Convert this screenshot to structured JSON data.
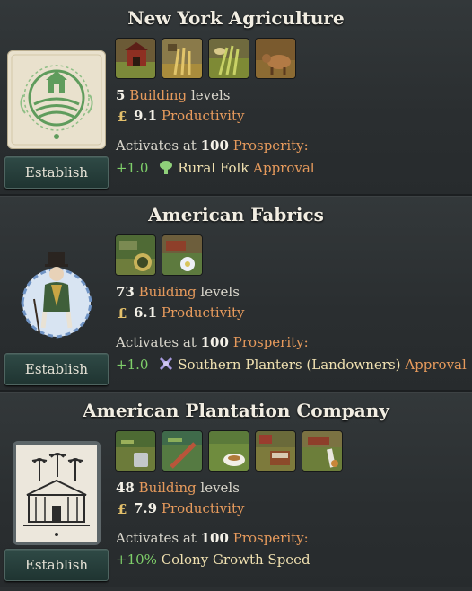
{
  "panels": [
    {
      "title": "New York Agriculture",
      "emblem": "farm-emblem",
      "building_icons": [
        "barn-building-icon",
        "wheat-farm-icon",
        "rye-farm-icon",
        "livestock-ranch-icon"
      ],
      "building_count": "5",
      "building_word": "Building",
      "levels_word": "levels",
      "productivity_value": "9.1",
      "productivity_word": "Productivity",
      "activates_prefix": "Activates at",
      "prosperity_value": "100",
      "prosperity_word": "Prosperity:",
      "effect_value": "+1.0",
      "effect_icon": "rural-folk-icon",
      "effect_label": "Rural Folk",
      "effect_suffix": "Approval",
      "button_label": "Establish"
    },
    {
      "title": "American Fabrics",
      "emblem": "dandy-emblem",
      "building_icons": [
        "cotton-plantation-icon",
        "textile-mill-icon"
      ],
      "building_count": "73",
      "building_word": "Building",
      "levels_word": "levels",
      "productivity_value": "6.1",
      "productivity_word": "Productivity",
      "activates_prefix": "Activates at",
      "prosperity_value": "100",
      "prosperity_word": "Prosperity:",
      "effect_value": "+1.0",
      "effect_icon": "landowners-icon",
      "effect_label": "Southern Planters (Landowners)",
      "effect_suffix": "Approval",
      "button_label": "Establish"
    },
    {
      "title": "American Plantation Company",
      "emblem": "plantation-house-emblem",
      "building_icons": [
        "coffee-plantation-icon",
        "tobacco-plantation-icon",
        "tea-plantation-icon",
        "sugar-plantation-icon",
        "vineyard-icon"
      ],
      "building_count": "48",
      "building_word": "Building",
      "levels_word": "levels",
      "productivity_value": "7.9",
      "productivity_word": "Productivity",
      "activates_prefix": "Activates at",
      "prosperity_value": "100",
      "prosperity_word": "Prosperity:",
      "effect_value": "+10%",
      "effect_label": "Colony Growth Speed",
      "button_label": "Establish"
    }
  ],
  "colors": {
    "background": "#2b2f31",
    "accent_orange": "#e69a5c",
    "positive_green": "#7fd06a",
    "button_teal": "#2f4a46"
  }
}
